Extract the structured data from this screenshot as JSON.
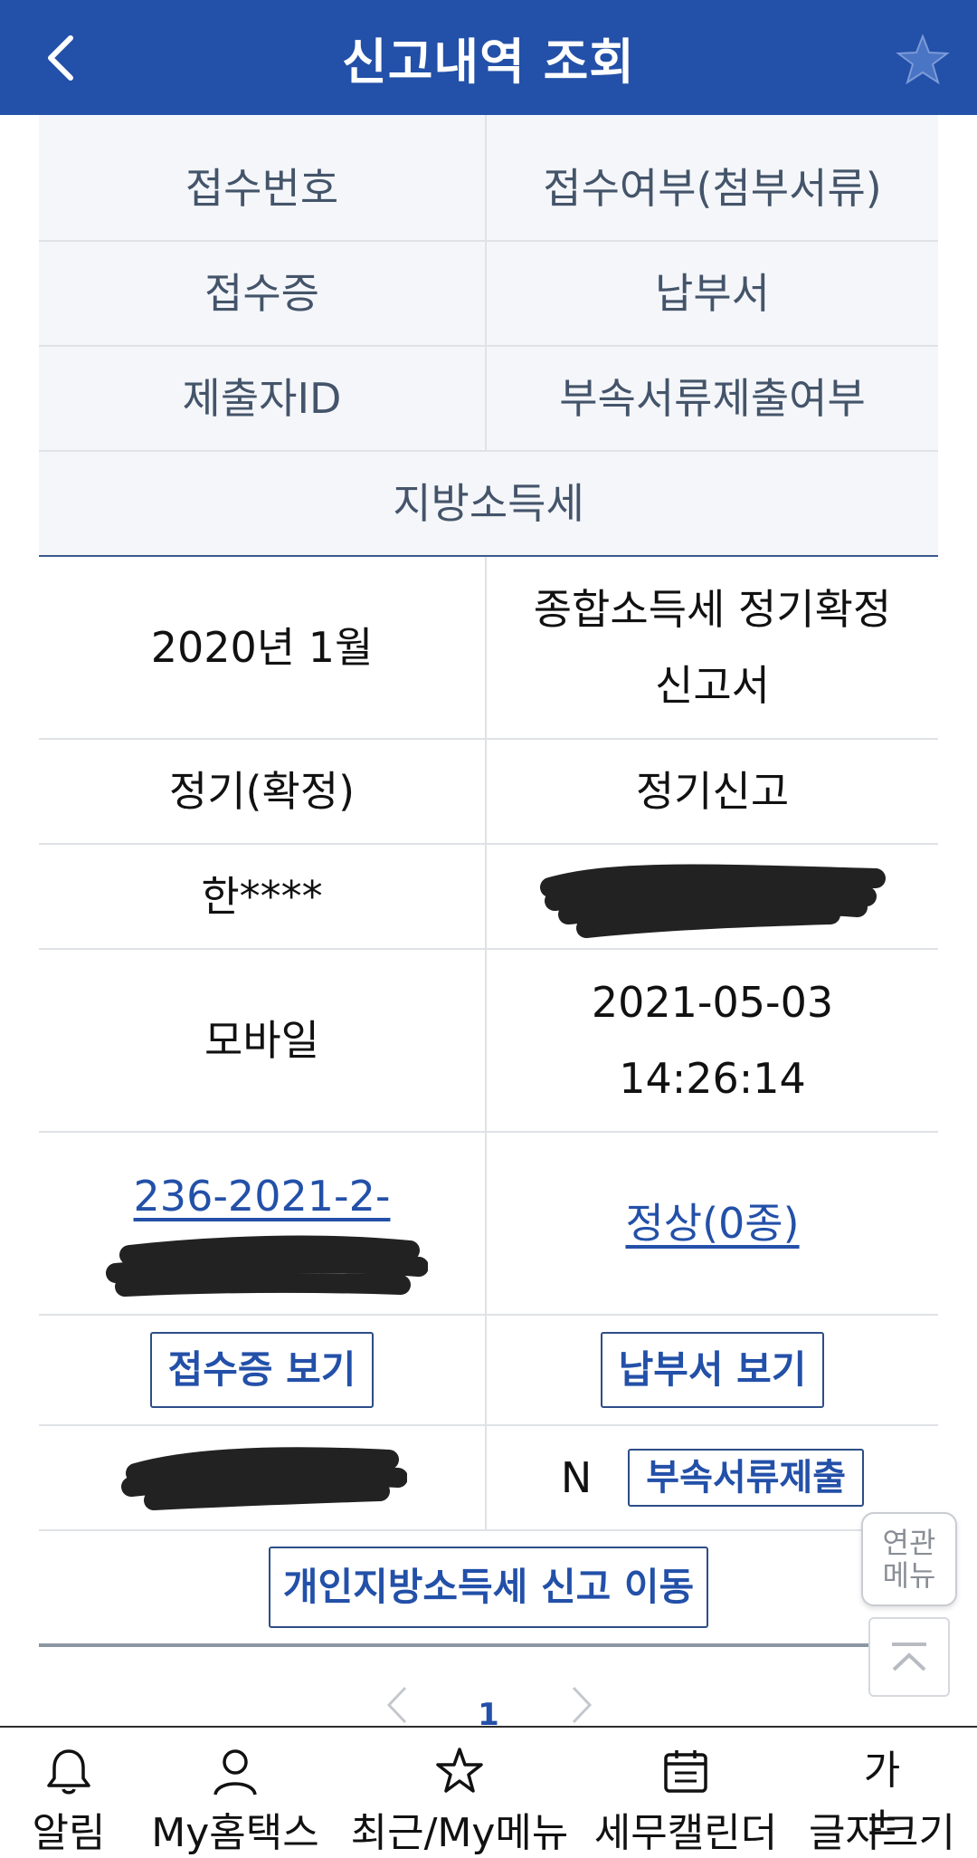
{
  "header": {
    "title": "신고내역 조회"
  },
  "table": {
    "head_rows": [
      [
        "접수번호",
        "접수여부(첨부서류)"
      ],
      [
        "접수증",
        "납부서"
      ],
      [
        "제출자ID",
        "부속서류제출여부"
      ]
    ],
    "head_full": "지방소득세",
    "period": "2020년 1월",
    "report_name_line1": "종합소득세 정기확정",
    "report_name_line2": "신고서",
    "report_type": "정기(확정)",
    "report_kind": "정기신고",
    "submitter_name": "한****",
    "method": "모바일",
    "date": "2021-05-03",
    "time": "14:26:14",
    "receipt_no_partial": "236-2021-2-",
    "receipt_status": "정상(0종)",
    "btn_receipt": "접수증 보기",
    "btn_payment": "납부서 보기",
    "attach_flag": "N",
    "btn_attach": "부속서류제출",
    "btn_local_tax": "개인지방소득세 신고 이동"
  },
  "side": {
    "related_menu": "연관\n메뉴"
  },
  "pager": {
    "current": "1"
  },
  "bottom_nav": [
    {
      "label": "알림",
      "icon": "bell-icon"
    },
    {
      "label": "My홈택스",
      "icon": "person-icon"
    },
    {
      "label": "최근/My메뉴",
      "icon": "star-outline-icon"
    },
    {
      "label": "세무캘린더",
      "icon": "calendar-icon"
    },
    {
      "label": "글자크기",
      "icon": "font-size-icon"
    }
  ],
  "colors": {
    "header_bg": "#2350a8",
    "accent": "#2350a8"
  }
}
